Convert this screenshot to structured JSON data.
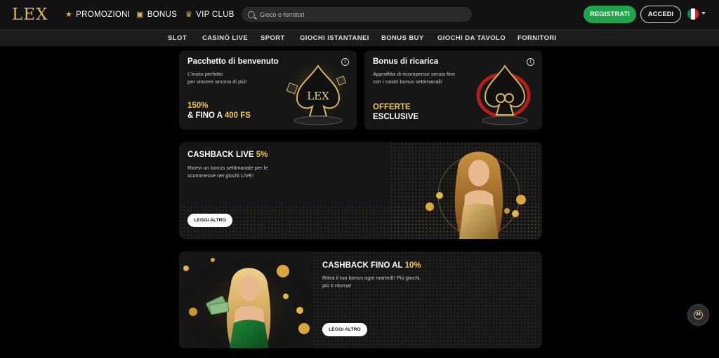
{
  "header": {
    "logo": "LEX",
    "nav": [
      {
        "label": "PROMOZIONI",
        "icon": "star-icon"
      },
      {
        "label": "BONUS",
        "icon": "gift-icon"
      },
      {
        "label": "VIP CLUB",
        "icon": "crown-icon"
      }
    ],
    "search_placeholder": "Gioco o fornitori",
    "register_label": "REGISTRATI",
    "login_label": "ACCEDI",
    "language_flag": "italy-flag-icon"
  },
  "categories": [
    "SLOT",
    "CASINÒ LIVE",
    "SPORT",
    "GIOCHI ISTANTANEI",
    "BONUS BUY",
    "GIOCHI DA TAVOLO",
    "FORNITORI"
  ],
  "cards": {
    "welcome": {
      "title": "Pacchetto di benvenuto",
      "desc_line1": "L'inizio perfetto",
      "desc_line2": "per vincere ancora di più!",
      "amount_line1": "150%",
      "amount_line2_prefix": "& FINO A ",
      "amount_line2_highlight": "400 FS",
      "emblem_text": "LEX"
    },
    "reload": {
      "title": "Bonus di ricarica",
      "desc_line1": "Approfitta di ricompense senza fine",
      "desc_line2": "con i nostri bonus settimanali!",
      "offer_line1": "OFFERTE",
      "offer_line2": "ESCLUSIVE"
    },
    "cashback_live": {
      "title_prefix": "CASHBACK LIVE ",
      "title_highlight": "5%",
      "desc_line1": "Ricevi un bonus settimanale per le",
      "desc_line2": "scommesse nei giochi LIVE!",
      "button": "LEGGI ALTRO"
    },
    "cashback_10": {
      "title_prefix": "CASHBACK FINO AL ",
      "title_highlight": "10%",
      "desc_line1": "Ritira il tuo bonus ogni martedì! Più giochi,",
      "desc_line2": "più ti ritorna!",
      "button": "LEGGI ALTRO"
    }
  },
  "support_badge": "24",
  "colors": {
    "accent_gold": "#f0c75e",
    "register_green": "#1ea54a",
    "background": "#000000"
  }
}
